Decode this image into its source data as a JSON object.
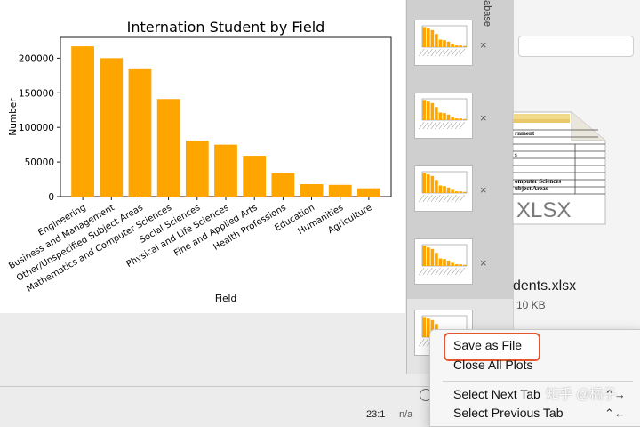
{
  "chart_data": {
    "type": "bar",
    "title": "Internation Student by Field",
    "xlabel": "Field",
    "ylabel": "Number",
    "categories": [
      "Engineering",
      "Business and Management",
      "Other/Unspecified Subject Areas",
      "Mathematics and Computer Sciences",
      "Social Sciences",
      "Physical and Life Sciences",
      "Fine and Applied Arts",
      "Health Professions",
      "Education",
      "Humanities",
      "Agriculture"
    ],
    "values": [
      217000,
      200000,
      184000,
      141000,
      81000,
      75000,
      59000,
      34000,
      18000,
      17000,
      12000
    ],
    "yticks": [
      "0",
      "50000",
      "100000",
      "150000",
      "200000"
    ],
    "ylim": [
      0,
      230000
    ],
    "bar_color": "#FFA500",
    "grid": false
  },
  "sidebar": {
    "tab_label": "abase",
    "close_glyph": "×",
    "thumbnails": [
      {
        "label": "Internation Student by Field"
      },
      {
        "label": "Internation Student by Field"
      },
      {
        "label": "Internation Student by Field"
      },
      {
        "label": "Internation Student by Field"
      },
      {
        "label": "Internation Student by Field"
      }
    ]
  },
  "preview": {
    "file_name": "dents.xlsx",
    "file_size": "10 KB",
    "doc_label": "XLSX",
    "doc_lines": [
      "rnment",
      "s",
      "omputer Sciences",
      "ubject Areas"
    ]
  },
  "status_bar": {
    "position": "23:1",
    "encoding": "n/a"
  },
  "context_menu": {
    "items": [
      {
        "label": "Save as File",
        "shortcut": ""
      },
      {
        "label": "Close All Plots",
        "shortcut": ""
      },
      {
        "label": "Select Next Tab",
        "shortcut": "⌃→"
      },
      {
        "label": "Select Previous Tab",
        "shortcut": "⌃←"
      }
    ]
  },
  "watermark": {
    "text": "知乎 @橘子"
  }
}
